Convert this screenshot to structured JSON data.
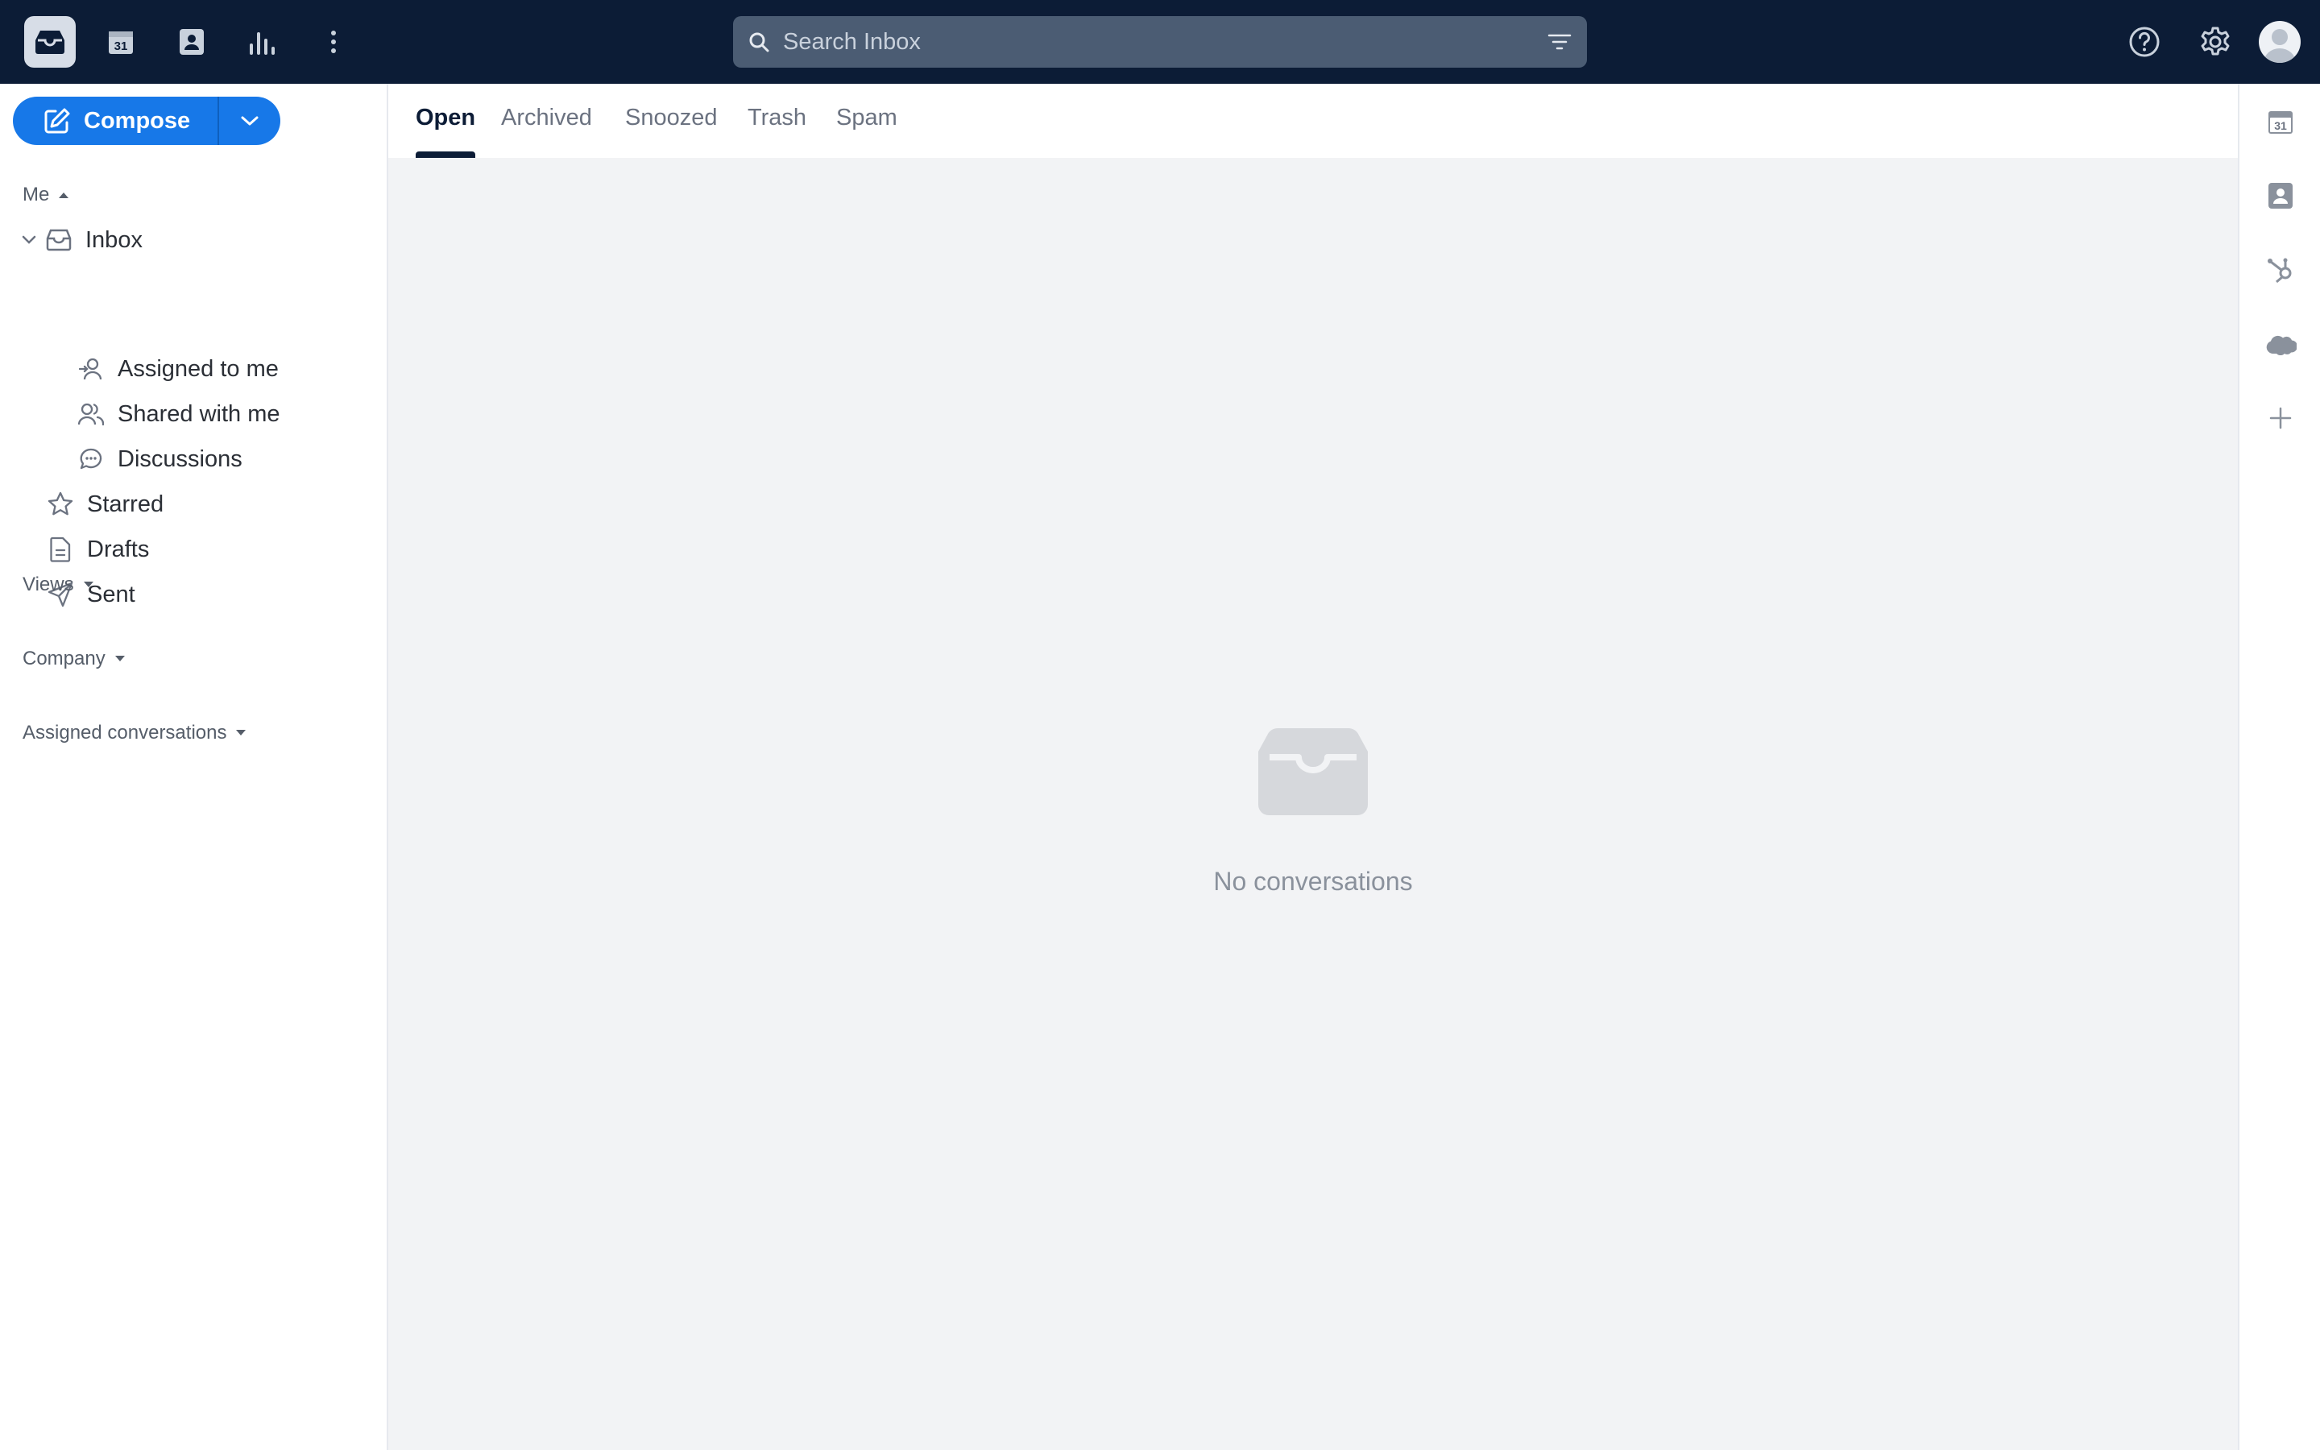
{
  "topbar": {
    "apps": [
      {
        "icon": "inbox-icon",
        "active": true
      },
      {
        "icon": "calendar-icon",
        "label": "31"
      },
      {
        "icon": "contacts-icon"
      },
      {
        "icon": "analytics-icon"
      },
      {
        "icon": "more-vertical-icon"
      }
    ],
    "search": {
      "placeholder": "Search Inbox",
      "value": ""
    },
    "right_icons": [
      "help-icon",
      "settings-icon",
      "avatar"
    ]
  },
  "sidebar": {
    "compose": {
      "label": "Compose"
    },
    "sections": {
      "me": "Me",
      "views": "Views",
      "company": "Company",
      "assigned": "Assigned conversations"
    },
    "items": {
      "inbox": "Inbox",
      "assigned_to_me": "Assigned to me",
      "shared_with_me": "Shared with me",
      "discussions": "Discussions",
      "starred": "Starred",
      "drafts": "Drafts",
      "sent": "Sent"
    }
  },
  "main": {
    "tabs": [
      "Open",
      "Archived",
      "Snoozed",
      "Trash",
      "Spam"
    ],
    "active_tab": "Open",
    "empty_message": "No conversations"
  },
  "rail": {
    "calendar_label": "31",
    "icons": [
      "calendar-icon",
      "contact-card-icon",
      "hubspot-icon",
      "salesforce-icon",
      "add-icon"
    ]
  },
  "colors": {
    "topbar": "#0c1c36",
    "accent": "#1778e8",
    "main_bg": "#f2f3f5"
  }
}
